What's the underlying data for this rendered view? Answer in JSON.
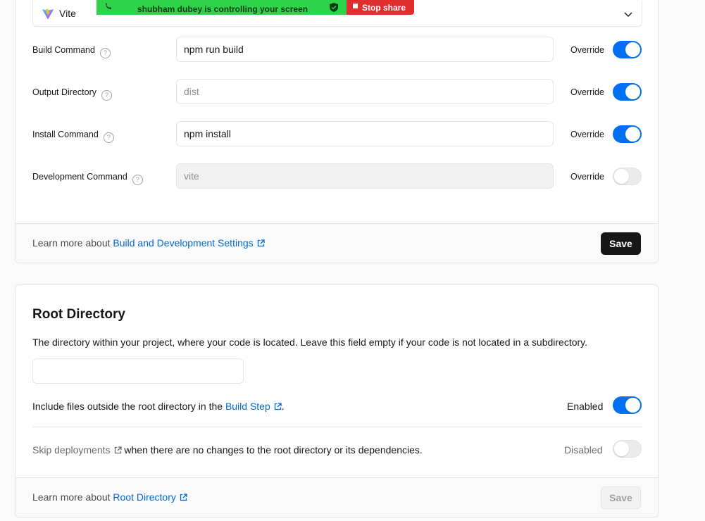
{
  "colors": {
    "accent": "#0070f3",
    "link": "#0068d6",
    "share_green": "#2fd34a",
    "share_red": "#e02e2e",
    "save_primary": "#171717"
  },
  "framework": {
    "name": "Vite",
    "logo_icon": "vite-logo-icon",
    "chevron_icon": "chevron-down-icon"
  },
  "screen_share": {
    "message": "shubham dubey is controlling your screen",
    "stop_label": "Stop share"
  },
  "build_settings": {
    "rows": [
      {
        "label": "Build Command",
        "value": "npm run build",
        "placeholder": "",
        "override_label": "Override",
        "override": true
      },
      {
        "label": "Output Directory",
        "value": "",
        "placeholder": "dist",
        "override_label": "Override",
        "override": true
      },
      {
        "label": "Install Command",
        "value": "npm install",
        "placeholder": "",
        "override_label": "Override",
        "override": true
      },
      {
        "label": "Development Command",
        "value": "",
        "placeholder": "vite",
        "override_label": "Override",
        "override": false
      }
    ],
    "footer_prefix": "Learn more about ",
    "footer_link": "Build and Development Settings",
    "save_label": "Save"
  },
  "root_directory": {
    "title": "Root Directory",
    "description": "The directory within your project, where your code is located. Leave this field empty if your code is not located in a subdirectory.",
    "input_value": "",
    "include_files": {
      "prefix": "Include files outside the root directory in the ",
      "link": "Build Step",
      "suffix": ".",
      "state_label": "Enabled",
      "enabled": true
    },
    "skip_deployments": {
      "link": "Skip deployments",
      "suffix": " when there are no changes to the root directory or its dependencies.",
      "state_label": "Disabled",
      "enabled": false
    },
    "footer_prefix": "Learn more about ",
    "footer_link": "Root Directory",
    "save_label": "Save"
  }
}
